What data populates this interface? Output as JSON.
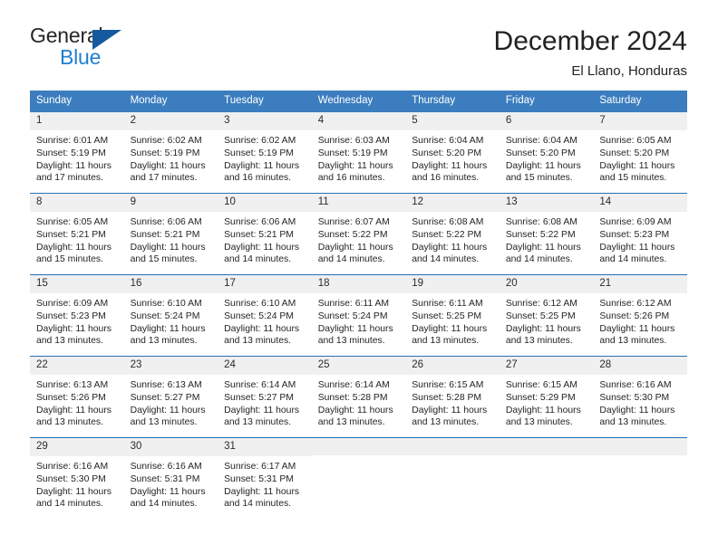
{
  "brand": {
    "word_one": "General",
    "word_two": "Blue",
    "logo_icon": "triangle-logo-icon"
  },
  "header": {
    "month_title": "December 2024",
    "location": "El Llano, Honduras"
  },
  "colors": {
    "header_blue": "#3b7dbe",
    "row_divider_blue": "#2870b3",
    "daynum_band": "#f0f0f0",
    "brand_blue": "#1f7fd0",
    "brand_triangle": "#145a9e"
  },
  "calendar": {
    "weekday_headers": [
      "Sunday",
      "Monday",
      "Tuesday",
      "Wednesday",
      "Thursday",
      "Friday",
      "Saturday"
    ],
    "weeks": [
      [
        {
          "day": "1",
          "sunrise": "Sunrise: 6:01 AM",
          "sunset": "Sunset: 5:19 PM",
          "daylight_line1": "Daylight: 11 hours",
          "daylight_line2": "and 17 minutes."
        },
        {
          "day": "2",
          "sunrise": "Sunrise: 6:02 AM",
          "sunset": "Sunset: 5:19 PM",
          "daylight_line1": "Daylight: 11 hours",
          "daylight_line2": "and 17 minutes."
        },
        {
          "day": "3",
          "sunrise": "Sunrise: 6:02 AM",
          "sunset": "Sunset: 5:19 PM",
          "daylight_line1": "Daylight: 11 hours",
          "daylight_line2": "and 16 minutes."
        },
        {
          "day": "4",
          "sunrise": "Sunrise: 6:03 AM",
          "sunset": "Sunset: 5:19 PM",
          "daylight_line1": "Daylight: 11 hours",
          "daylight_line2": "and 16 minutes."
        },
        {
          "day": "5",
          "sunrise": "Sunrise: 6:04 AM",
          "sunset": "Sunset: 5:20 PM",
          "daylight_line1": "Daylight: 11 hours",
          "daylight_line2": "and 16 minutes."
        },
        {
          "day": "6",
          "sunrise": "Sunrise: 6:04 AM",
          "sunset": "Sunset: 5:20 PM",
          "daylight_line1": "Daylight: 11 hours",
          "daylight_line2": "and 15 minutes."
        },
        {
          "day": "7",
          "sunrise": "Sunrise: 6:05 AM",
          "sunset": "Sunset: 5:20 PM",
          "daylight_line1": "Daylight: 11 hours",
          "daylight_line2": "and 15 minutes."
        }
      ],
      [
        {
          "day": "8",
          "sunrise": "Sunrise: 6:05 AM",
          "sunset": "Sunset: 5:21 PM",
          "daylight_line1": "Daylight: 11 hours",
          "daylight_line2": "and 15 minutes."
        },
        {
          "day": "9",
          "sunrise": "Sunrise: 6:06 AM",
          "sunset": "Sunset: 5:21 PM",
          "daylight_line1": "Daylight: 11 hours",
          "daylight_line2": "and 15 minutes."
        },
        {
          "day": "10",
          "sunrise": "Sunrise: 6:06 AM",
          "sunset": "Sunset: 5:21 PM",
          "daylight_line1": "Daylight: 11 hours",
          "daylight_line2": "and 14 minutes."
        },
        {
          "day": "11",
          "sunrise": "Sunrise: 6:07 AM",
          "sunset": "Sunset: 5:22 PM",
          "daylight_line1": "Daylight: 11 hours",
          "daylight_line2": "and 14 minutes."
        },
        {
          "day": "12",
          "sunrise": "Sunrise: 6:08 AM",
          "sunset": "Sunset: 5:22 PM",
          "daylight_line1": "Daylight: 11 hours",
          "daylight_line2": "and 14 minutes."
        },
        {
          "day": "13",
          "sunrise": "Sunrise: 6:08 AM",
          "sunset": "Sunset: 5:22 PM",
          "daylight_line1": "Daylight: 11 hours",
          "daylight_line2": "and 14 minutes."
        },
        {
          "day": "14",
          "sunrise": "Sunrise: 6:09 AM",
          "sunset": "Sunset: 5:23 PM",
          "daylight_line1": "Daylight: 11 hours",
          "daylight_line2": "and 14 minutes."
        }
      ],
      [
        {
          "day": "15",
          "sunrise": "Sunrise: 6:09 AM",
          "sunset": "Sunset: 5:23 PM",
          "daylight_line1": "Daylight: 11 hours",
          "daylight_line2": "and 13 minutes."
        },
        {
          "day": "16",
          "sunrise": "Sunrise: 6:10 AM",
          "sunset": "Sunset: 5:24 PM",
          "daylight_line1": "Daylight: 11 hours",
          "daylight_line2": "and 13 minutes."
        },
        {
          "day": "17",
          "sunrise": "Sunrise: 6:10 AM",
          "sunset": "Sunset: 5:24 PM",
          "daylight_line1": "Daylight: 11 hours",
          "daylight_line2": "and 13 minutes."
        },
        {
          "day": "18",
          "sunrise": "Sunrise: 6:11 AM",
          "sunset": "Sunset: 5:24 PM",
          "daylight_line1": "Daylight: 11 hours",
          "daylight_line2": "and 13 minutes."
        },
        {
          "day": "19",
          "sunrise": "Sunrise: 6:11 AM",
          "sunset": "Sunset: 5:25 PM",
          "daylight_line1": "Daylight: 11 hours",
          "daylight_line2": "and 13 minutes."
        },
        {
          "day": "20",
          "sunrise": "Sunrise: 6:12 AM",
          "sunset": "Sunset: 5:25 PM",
          "daylight_line1": "Daylight: 11 hours",
          "daylight_line2": "and 13 minutes."
        },
        {
          "day": "21",
          "sunrise": "Sunrise: 6:12 AM",
          "sunset": "Sunset: 5:26 PM",
          "daylight_line1": "Daylight: 11 hours",
          "daylight_line2": "and 13 minutes."
        }
      ],
      [
        {
          "day": "22",
          "sunrise": "Sunrise: 6:13 AM",
          "sunset": "Sunset: 5:26 PM",
          "daylight_line1": "Daylight: 11 hours",
          "daylight_line2": "and 13 minutes."
        },
        {
          "day": "23",
          "sunrise": "Sunrise: 6:13 AM",
          "sunset": "Sunset: 5:27 PM",
          "daylight_line1": "Daylight: 11 hours",
          "daylight_line2": "and 13 minutes."
        },
        {
          "day": "24",
          "sunrise": "Sunrise: 6:14 AM",
          "sunset": "Sunset: 5:27 PM",
          "daylight_line1": "Daylight: 11 hours",
          "daylight_line2": "and 13 minutes."
        },
        {
          "day": "25",
          "sunrise": "Sunrise: 6:14 AM",
          "sunset": "Sunset: 5:28 PM",
          "daylight_line1": "Daylight: 11 hours",
          "daylight_line2": "and 13 minutes."
        },
        {
          "day": "26",
          "sunrise": "Sunrise: 6:15 AM",
          "sunset": "Sunset: 5:28 PM",
          "daylight_line1": "Daylight: 11 hours",
          "daylight_line2": "and 13 minutes."
        },
        {
          "day": "27",
          "sunrise": "Sunrise: 6:15 AM",
          "sunset": "Sunset: 5:29 PM",
          "daylight_line1": "Daylight: 11 hours",
          "daylight_line2": "and 13 minutes."
        },
        {
          "day": "28",
          "sunrise": "Sunrise: 6:16 AM",
          "sunset": "Sunset: 5:30 PM",
          "daylight_line1": "Daylight: 11 hours",
          "daylight_line2": "and 13 minutes."
        }
      ],
      [
        {
          "day": "29",
          "sunrise": "Sunrise: 6:16 AM",
          "sunset": "Sunset: 5:30 PM",
          "daylight_line1": "Daylight: 11 hours",
          "daylight_line2": "and 14 minutes."
        },
        {
          "day": "30",
          "sunrise": "Sunrise: 6:16 AM",
          "sunset": "Sunset: 5:31 PM",
          "daylight_line1": "Daylight: 11 hours",
          "daylight_line2": "and 14 minutes."
        },
        {
          "day": "31",
          "sunrise": "Sunrise: 6:17 AM",
          "sunset": "Sunset: 5:31 PM",
          "daylight_line1": "Daylight: 11 hours",
          "daylight_line2": "and 14 minutes."
        },
        {
          "day": "",
          "sunrise": "",
          "sunset": "",
          "daylight_line1": "",
          "daylight_line2": ""
        },
        {
          "day": "",
          "sunrise": "",
          "sunset": "",
          "daylight_line1": "",
          "daylight_line2": ""
        },
        {
          "day": "",
          "sunrise": "",
          "sunset": "",
          "daylight_line1": "",
          "daylight_line2": ""
        },
        {
          "day": "",
          "sunrise": "",
          "sunset": "",
          "daylight_line1": "",
          "daylight_line2": ""
        }
      ]
    ]
  }
}
